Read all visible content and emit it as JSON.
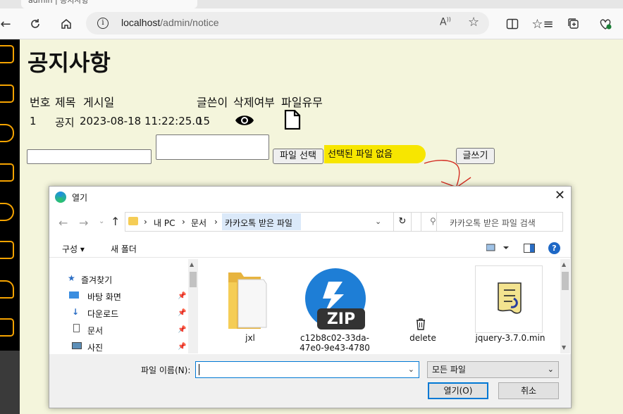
{
  "browser": {
    "tab_title": "admin | 공지사항",
    "url_host": "localhost",
    "url_path": "/admin/notice",
    "icons": [
      "back-icon",
      "refresh-icon",
      "home-icon",
      "info-icon",
      "read-aloud-icon",
      "favorite-icon",
      "split-screen-icon",
      "favorites-bar-icon",
      "collections-icon",
      "extensions-icon"
    ]
  },
  "sidebar": {
    "accent_color": "#f5a300",
    "icons": [
      "board-icon",
      "clipboard-icon",
      "users-icon",
      "chat-icon",
      "more-icon",
      "mail-icon",
      "bell-icon",
      "logout-icon"
    ]
  },
  "page": {
    "title": "공지사항",
    "columns": {
      "number": "번호",
      "title": "제목",
      "date": "게시일",
      "author": "글쓴이",
      "deleted": "삭제여부",
      "file": "파일유무"
    },
    "rows": [
      {
        "number": "1",
        "title": "공지",
        "date": "2023-08-18 11:22:25.0",
        "author": "15"
      }
    ],
    "form": {
      "file_button": "파일 선택",
      "file_status": "선택된 파일 없음",
      "write_button": "글쓰기"
    },
    "highlight_color": "#f7e600",
    "annotation_color": "#d42a1f"
  },
  "dialog": {
    "title": "열기",
    "close": "✕",
    "path": [
      "내 PC",
      "문서",
      "카카오톡 받은 파일"
    ],
    "search_placeholder": "카카오톡 받은 파일 검색",
    "organize": "구성 ▾",
    "new_folder": "새 폴더",
    "help": "?",
    "nav": [
      {
        "label": "즐겨찾기",
        "icon": "star-icon",
        "pinned": false
      },
      {
        "label": "바탕 화면",
        "icon": "desktop-icon",
        "pinned": true
      },
      {
        "label": "다운로드",
        "icon": "download-icon",
        "pinned": true
      },
      {
        "label": "문서",
        "icon": "document-icon",
        "pinned": true
      },
      {
        "label": "사진",
        "icon": "pictures-icon",
        "pinned": true
      }
    ],
    "files": [
      {
        "name": "jxl",
        "icon": "folder-icon"
      },
      {
        "name": "c12b8c02-33da-47e0-9e43-4780",
        "icon": "zip-icon",
        "badge": "ZIP"
      },
      {
        "name": "delete",
        "icon": "trash-icon"
      },
      {
        "name": "jquery-3.7.0.min",
        "icon": "script-file-icon"
      }
    ],
    "filename_label": "파일 이름(N):",
    "filename_value": "",
    "filetype": "모든 파일",
    "open_button": "열기(O)",
    "cancel_button": "취소"
  }
}
